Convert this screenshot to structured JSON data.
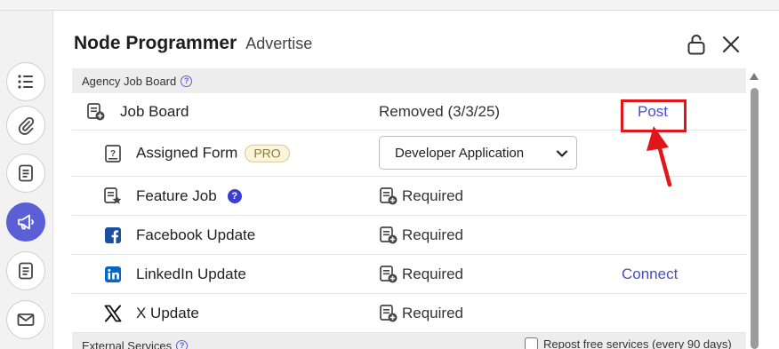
{
  "header": {
    "title": "Node Programmer",
    "subtitle": "Advertise",
    "lock_icon": "unlock-icon",
    "close_icon": "close-icon"
  },
  "rail": {
    "items": [
      {
        "icon": "list-icon",
        "active": false
      },
      {
        "icon": "paperclip-icon",
        "active": false
      },
      {
        "icon": "document-icon",
        "active": false
      },
      {
        "icon": "megaphone-icon",
        "active": true
      },
      {
        "icon": "document-icon",
        "active": false
      },
      {
        "icon": "envelope-icon",
        "active": false
      }
    ]
  },
  "sections": {
    "agency": {
      "label": "Agency Job Board"
    },
    "external": {
      "label": "External Services",
      "repost_label": "Repost free services (every 90 days)",
      "repost_checked": false
    }
  },
  "rows": {
    "job_board": {
      "label": "Job Board",
      "status": "Removed (3/3/25)",
      "action": "Post"
    },
    "assigned_form": {
      "label": "Assigned Form",
      "badge": "PRO",
      "selected": "Developer Application"
    },
    "feature_job": {
      "label": "Feature Job",
      "help": "?",
      "value": "Required"
    },
    "facebook": {
      "label": "Facebook Update",
      "value": "Required"
    },
    "linkedin": {
      "label": "LinkedIn Update",
      "value": "Required",
      "action": "Connect"
    },
    "x": {
      "label": "X Update",
      "value": "Required"
    }
  },
  "colors": {
    "accent": "#5b5fd6",
    "link": "#4a4ec4",
    "highlight": "#e0161b",
    "facebook": "#1877f2",
    "linkedin": "#0a66c2"
  }
}
